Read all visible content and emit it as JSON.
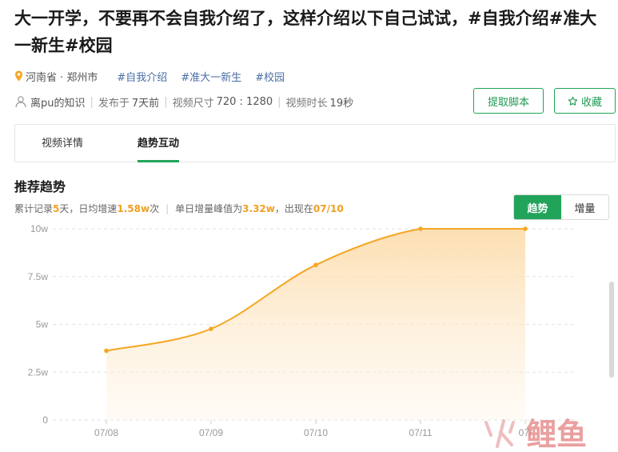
{
  "video": {
    "title": "大一开学，不要再不会自我介绍了，这样介绍以下自己试试，#自我介绍#准大一新生#校园",
    "location": "河南省 · 郑州市",
    "tags": [
      "#自我介绍",
      "#准大一新生",
      "#校园"
    ],
    "author": "离pu的知识",
    "published_label": "发布于",
    "published_value": "7天前",
    "size_label": "视频尺寸",
    "size_value": "720 : 1280",
    "duration_label": "视频时长",
    "duration_value": "19秒"
  },
  "actions": {
    "extract_script": "提取脚本",
    "favorite": "收藏"
  },
  "tabs": [
    "视频详情",
    "趋势互动"
  ],
  "trend": {
    "section_title": "推荐趋势",
    "summary": {
      "p1": "累计记录",
      "days": "5",
      "p2": "天，日均增速",
      "avg": "1.58w",
      "p3": "次",
      "p4": "单日增量峰值为",
      "peak": "3.32w",
      "p5": "，出现在",
      "peak_date": "07/10"
    },
    "toggle": [
      "趋势",
      "增量"
    ]
  },
  "colors": {
    "accent": "#21a45a",
    "line": "#f5a623",
    "highlight": "#f0a020"
  },
  "chart_data": {
    "type": "area",
    "x": [
      "07/08",
      "07/09",
      "07/10",
      "07/11",
      "07/12"
    ],
    "x_tick_labels": [
      "07/08",
      "07/09",
      "07/10",
      "07/11",
      "07/"
    ],
    "y": [
      3.62,
      4.77,
      8.11,
      10.0,
      10.0
    ],
    "y_unit": "w",
    "y_ticks": [
      "0",
      "2.5w",
      "5w",
      "7.5w",
      "10w"
    ],
    "ylim": [
      0,
      10
    ],
    "grid": "horizontal dashed"
  },
  "watermark": {
    "text": "鲤鱼"
  }
}
